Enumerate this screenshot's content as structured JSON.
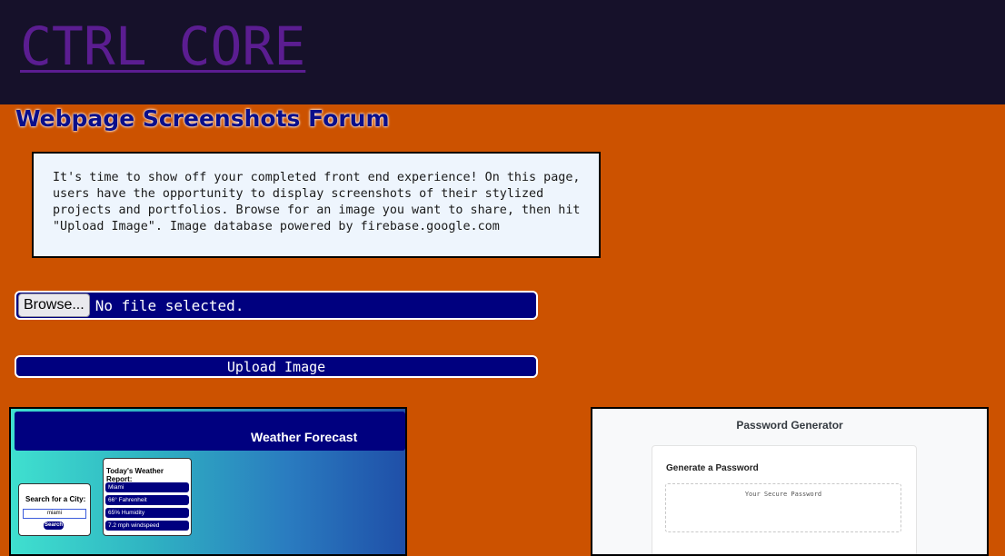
{
  "header": {
    "brand": "CTRL CORE"
  },
  "page": {
    "title": "Webpage Screenshots Forum",
    "intro": "It's time to show off your completed front end experience! On this page, users have the opportunity to display screenshots of their stylized projects and portfolios. Browse for an image you want to share, then hit \"Upload Image\". Image database powered by firebase.google.com"
  },
  "upload": {
    "browse_label": "Browse...",
    "file_status": "No file selected.",
    "upload_label": "Upload Image"
  },
  "gallery": {
    "weather": {
      "title": "Weather Forecast",
      "search_label": "Search for a City:",
      "search_value": "miami",
      "search_button": "Search",
      "report_title": "Today's Weather Report:",
      "rows": [
        "Miami",
        "66° Fahrenheit",
        "65% Humidity",
        "7.2 mph windspeed"
      ]
    },
    "password": {
      "title": "Password Generator",
      "panel_heading": "Generate a Password",
      "placeholder": "Your Secure Password"
    }
  },
  "colors": {
    "page_bg": "#cc5200",
    "topbar_bg": "#16112a",
    "brand": "#5b1d91",
    "accent_navy": "#00007f"
  }
}
